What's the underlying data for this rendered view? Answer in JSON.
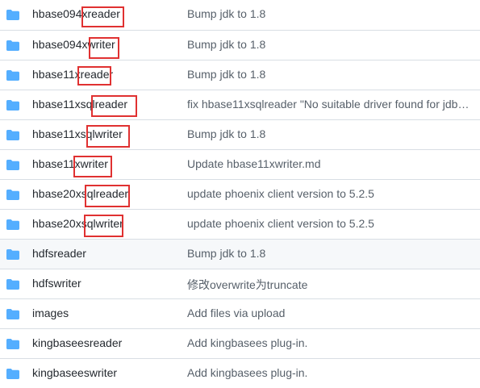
{
  "accent_colors": {
    "folder": "#54aeff",
    "highlight_box": "#e03131",
    "hover_row": "#f6f8fa"
  },
  "rows": [
    {
      "name": "hbase094xreader",
      "commit_message": "Bump jdk to 1.8",
      "icon": "folder-icon",
      "highlighted": true
    },
    {
      "name": "hbase094xwriter",
      "commit_message": "Bump jdk to 1.8",
      "icon": "folder-icon",
      "highlighted": true
    },
    {
      "name": "hbase11xreader",
      "commit_message": "Bump jdk to 1.8",
      "icon": "folder-icon",
      "highlighted": true
    },
    {
      "name": "hbase11xsqlreader",
      "commit_message": "fix hbase11xsqlreader \"No suitable driver found for jdbc:phoenix\"",
      "icon": "folder-icon",
      "highlighted": true
    },
    {
      "name": "hbase11xsqlwriter",
      "commit_message": "Bump jdk to 1.8",
      "icon": "folder-icon",
      "highlighted": true
    },
    {
      "name": "hbase11xwriter",
      "commit_message": "Update hbase11xwriter.md",
      "icon": "folder-icon",
      "highlighted": true
    },
    {
      "name": "hbase20xsqlreader",
      "commit_message": "update phoenix client version to 5.2.5",
      "icon": "folder-icon",
      "highlighted": true
    },
    {
      "name": "hbase20xsqlwriter",
      "commit_message": "update phoenix client version to 5.2.5",
      "icon": "folder-icon",
      "highlighted": true
    },
    {
      "name": "hdfsreader",
      "commit_message": "Bump jdk to 1.8",
      "icon": "folder-icon",
      "highlighted": false
    },
    {
      "name": "hdfswriter",
      "commit_message": "修改overwrite为truncate",
      "icon": "folder-icon",
      "highlighted": false
    },
    {
      "name": "images",
      "commit_message": "Add files via upload",
      "icon": "folder-icon",
      "highlighted": false
    },
    {
      "name": "kingbaseesreader",
      "commit_message": "Add kingbasees plug-in.",
      "icon": "folder-icon",
      "highlighted": false
    },
    {
      "name": "kingbaseeswriter",
      "commit_message": "Add kingbasees plug-in.",
      "icon": "folder-icon",
      "highlighted": false
    }
  ]
}
